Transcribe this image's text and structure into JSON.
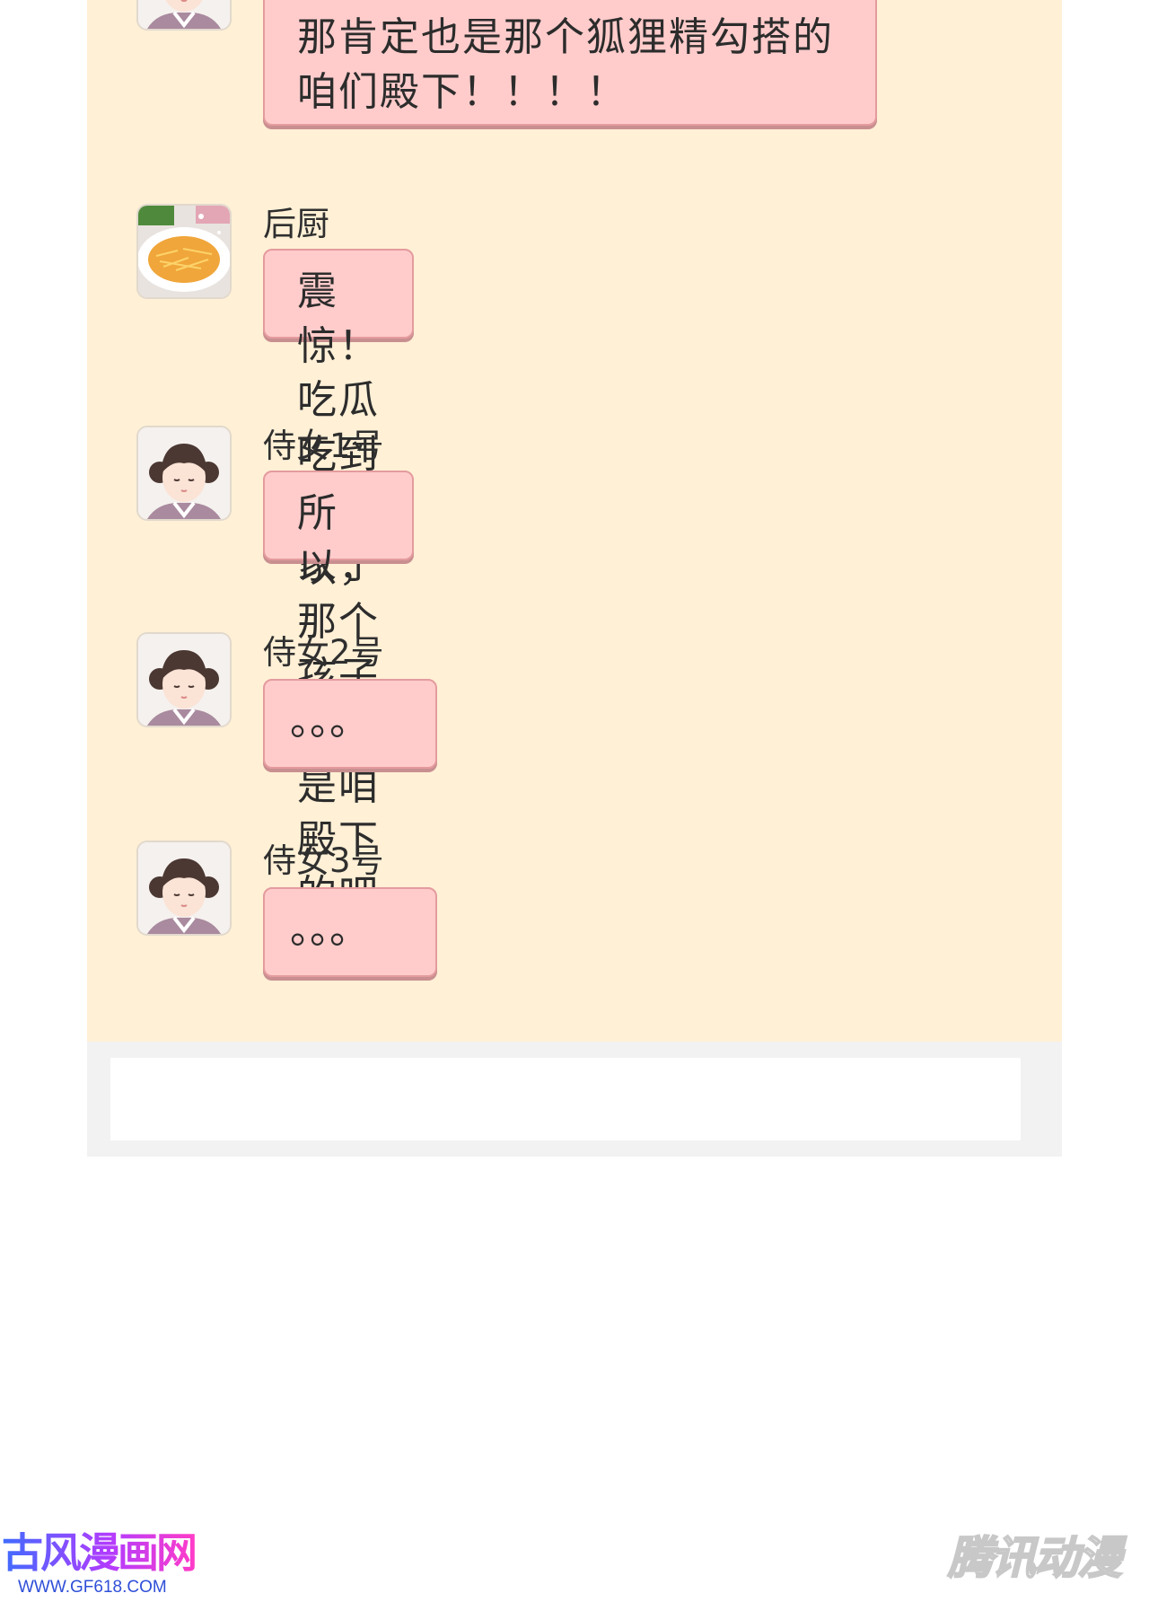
{
  "chat": {
    "messages": [
      {
        "avatar": "maid-avatar-icon",
        "sender": "",
        "text": "那肯定也是那个狐狸精勾搭的\n咱们殿下！！！！"
      },
      {
        "avatar": "food-dish-avatar-icon",
        "sender": "后厨",
        "text": "震惊！吃瓜吃到自己家了"
      },
      {
        "avatar": "maid-avatar-icon",
        "sender": "侍女1号",
        "text": "所以，那个孩子不会是咱殿下的吧"
      },
      {
        "avatar": "maid-avatar-icon",
        "sender": "侍女2号",
        "text": "。。。"
      },
      {
        "avatar": "maid-avatar-icon",
        "sender": "侍女3号",
        "text": "。。。"
      }
    ]
  },
  "input": {
    "value": ""
  },
  "watermarks": {
    "left_title": "古风漫画网",
    "left_url": "WWW.GF618.COM",
    "right_title": "腾讯动漫"
  },
  "colors": {
    "chat_background": "#fff0d6",
    "bubble": "#ffcccb",
    "input_bar": "#f2f2f2"
  }
}
